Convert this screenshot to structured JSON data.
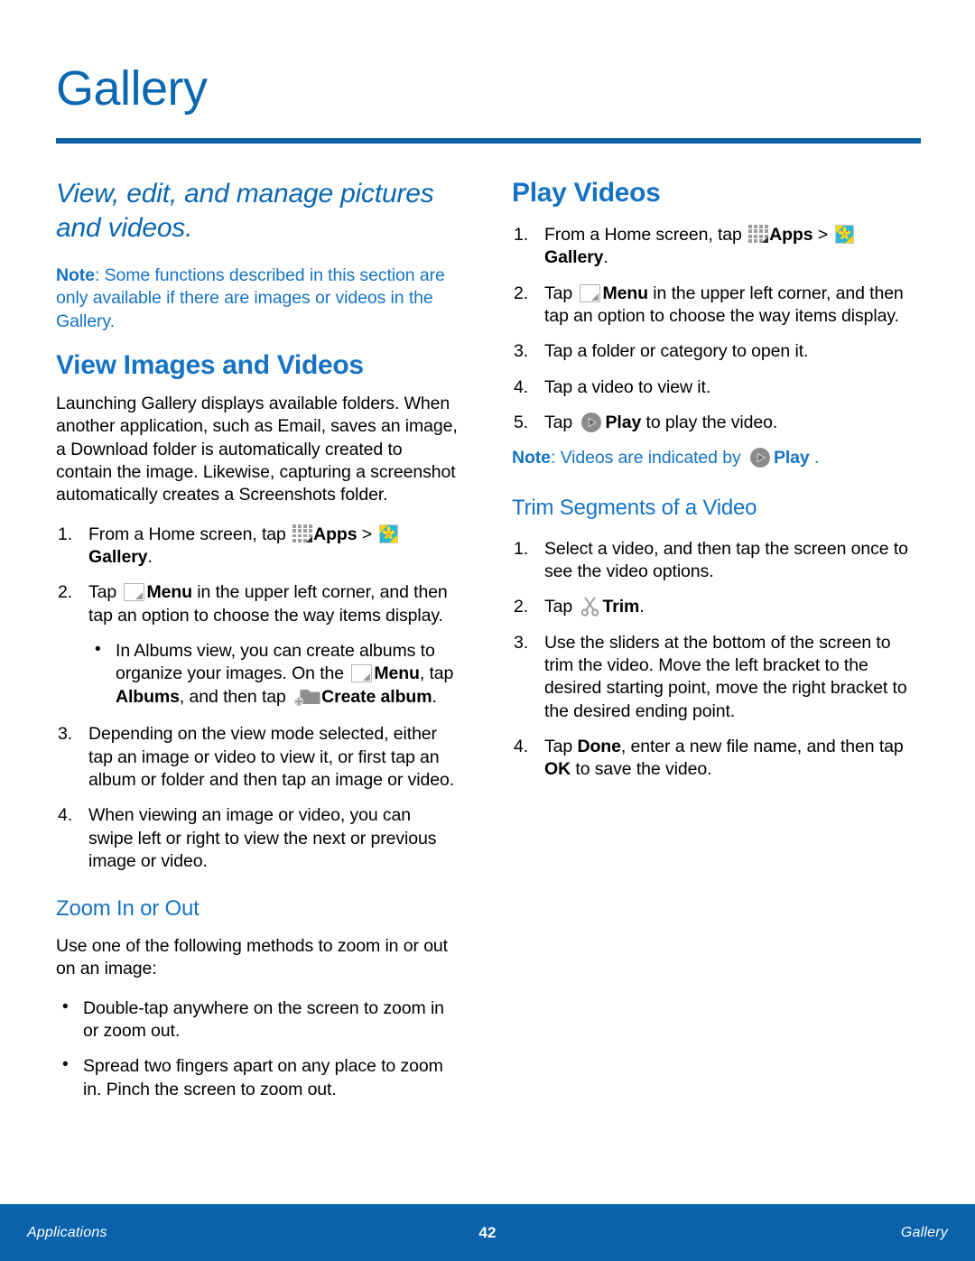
{
  "page": {
    "title": "Gallery",
    "accent_blue": "#0a67b1",
    "heading_blue": "#1673c4",
    "rule_blue": "#0a5fa5",
    "footer_blue": "#0a62ab"
  },
  "left": {
    "section_title": "View, edit, and manage pictures and videos.",
    "note_label": "Note",
    "note_text": ": Some functions described in this section are only available if there are images or videos in the Gallery.",
    "view_images": {
      "heading": "View Images and Videos",
      "intro": "Launching Gallery displays available folders. When another application, such as Email, saves an image, a Download folder is automatically created to contain the image. Likewise, capturing a screenshot automatically creates a Screenshots folder.",
      "step1_num": "1.",
      "step1_a": "From a Home screen, tap ",
      "step1_apps": "Apps",
      "step1_sep": " > ",
      "step1_gallery": "Gallery",
      "step1_end": ".",
      "step2_num": "2.",
      "step2_a": "Tap ",
      "step2_menu": "Menu",
      "step2_b": " in the upper left corner, and then tap an option to choose the way items display.",
      "bullet1_a": "In Albums view, you can create albums to organize your images. On the ",
      "bullet1_menu": "Menu",
      "bullet1_b": ", tap ",
      "bullet1_albums": "Albums",
      "bullet1_c": ", and then tap ",
      "bullet1_create": "Create album",
      "bullet1_d": ".",
      "step3_num": "3.",
      "step3": "Depending on the view mode selected, either tap an image or video to view it, or first tap an album or folder and then tap an image or video.",
      "step4_num": "4.",
      "step4": "When viewing an image or video, you can swipe left or right to view the next or previous image or video."
    },
    "zoom": {
      "heading": "Zoom In or Out",
      "intro": "Use one of the following methods to zoom in or out on an image:",
      "bullet1": "Double-tap anywhere on the screen to zoom in or zoom out.",
      "bullet2": "Spread two fingers apart on any place to zoom in. Pinch the screen to zoom out."
    }
  },
  "right": {
    "play_videos": {
      "heading": "Play Videos",
      "step1_num": "1.",
      "step1_a": "From a Home screen, tap ",
      "step1_apps": "Apps",
      "step1_sep": " > ",
      "step1_gallery": "Gallery",
      "step1_end": ".",
      "step2_num": "2.",
      "step2_a": "Tap ",
      "step2_menu": "Menu",
      "step2_b": " in the upper left corner, and then tap an option to choose the way items display.",
      "step3_num": "3.",
      "step3": "Tap a folder or category to open it.",
      "step4_num": "4.",
      "step4": "Tap a video to view it.",
      "step5_num": "5.",
      "step5_a": "Tap ",
      "step5_play": "Play",
      "step5_b": " to play the video.",
      "note_label": "Note",
      "note_a": ": Videos are indicated by ",
      "note_play": "Play",
      "note_b": " ."
    },
    "trim": {
      "heading": "Trim Segments of a Video",
      "step1_num": "1.",
      "step1": "Select a video, and then tap the screen once to see the video options.",
      "step2_num": "2.",
      "step2_a": "Tap ",
      "step2_trim": "Trim",
      "step2_b": ".",
      "step3_num": "3.",
      "step3": "Use the sliders at the bottom of the screen to trim the video. Move the left bracket to the desired starting point, move the right bracket to the desired ending point.",
      "step4_num": "4.",
      "step4_a": "Tap ",
      "step4_done": "Done",
      "step4_b": ", enter a new file name, and then tap ",
      "step4_ok": "OK",
      "step4_c": " to save the video."
    }
  },
  "footer": {
    "left": "Applications",
    "center": "42",
    "right": "Gallery"
  },
  "icons": {
    "apps": "apps-grid-icon",
    "gallery": "gallery-flower-icon",
    "menu": "menu-icon",
    "create_album": "create-album-folder-icon",
    "play": "play-icon",
    "trim": "scissors-icon"
  }
}
